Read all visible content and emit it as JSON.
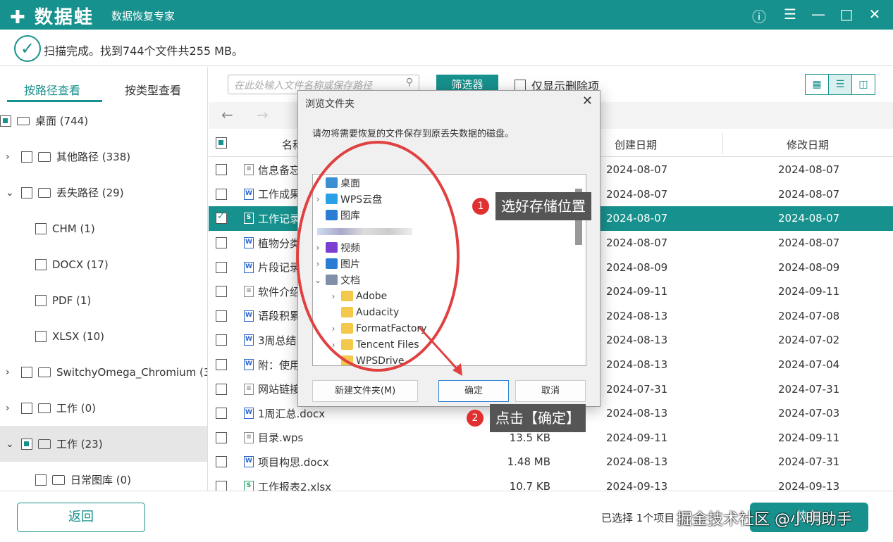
{
  "app": {
    "logo": "数据蛙",
    "subtitle": "数据恢复专家",
    "window_buttons": [
      "help-icon",
      "menu-icon",
      "minimize-icon",
      "maximize-icon",
      "close-icon"
    ]
  },
  "status": {
    "text": "扫描完成。找到744个文件共255 MB。"
  },
  "left": {
    "tabs": [
      "按路径查看",
      "按类型查看"
    ],
    "tree": [
      {
        "label": "桌面 (744)",
        "check": "partial",
        "indent": 0,
        "arrow": "",
        "icon": "desktop"
      },
      {
        "label": "其他路径 (338)",
        "check": "none",
        "indent": 1,
        "arrow": "right",
        "icon": "folder"
      },
      {
        "label": "丢失路径 (29)",
        "check": "none",
        "indent": 1,
        "arrow": "down",
        "icon": "folder"
      },
      {
        "label": "CHM (1)",
        "check": "none",
        "indent": 2,
        "arrow": "",
        "icon": ""
      },
      {
        "label": "DOCX (17)",
        "check": "none",
        "indent": 2,
        "arrow": "",
        "icon": ""
      },
      {
        "label": "PDF (1)",
        "check": "none",
        "indent": 2,
        "arrow": "",
        "icon": ""
      },
      {
        "label": "XLSX (10)",
        "check": "none",
        "indent": 2,
        "arrow": "",
        "icon": ""
      },
      {
        "label": "SwitchyOmega_Chromium (3",
        "check": "none",
        "indent": 1,
        "arrow": "right",
        "icon": "folder"
      },
      {
        "label": "工作 (0)",
        "check": "none",
        "indent": 1,
        "arrow": "right",
        "icon": "folder"
      },
      {
        "label": "工作 (23)",
        "check": "partial",
        "indent": 1,
        "arrow": "down",
        "icon": "folder",
        "selected": true
      },
      {
        "label": "日常图库 (0)",
        "check": "none",
        "indent": 2,
        "arrow": "",
        "icon": "folder"
      }
    ]
  },
  "toolbar": {
    "search_placeholder": "在此处输入文件名称或保存路径",
    "filter": "筛选器",
    "only_deleted": "仅显示删除项"
  },
  "table": {
    "headers": [
      "名称",
      "创建日期",
      "修改日期"
    ],
    "rows": [
      {
        "name": "信息备忘.tx",
        "size": "",
        "created": "2024-08-07",
        "modified": "2024-08-07",
        "type": "txt"
      },
      {
        "name": "工作成果分",
        "size": "",
        "created": "2024-08-07",
        "modified": "2024-08-07",
        "type": "doc"
      },
      {
        "name": "工作记录表",
        "size": "",
        "created": "2024-08-07",
        "modified": "2024-08-07",
        "type": "xls",
        "selected": true
      },
      {
        "name": "植物分类.d",
        "size": "",
        "created": "2024-08-07",
        "modified": "2024-08-07",
        "type": "doc"
      },
      {
        "name": "片段记录.d",
        "size": "",
        "created": "2024-08-09",
        "modified": "2024-08-09",
        "type": "doc"
      },
      {
        "name": "软件介绍 -",
        "size": "",
        "created": "2024-09-11",
        "modified": "2024-09-11",
        "type": "txt"
      },
      {
        "name": "语段积累.d",
        "size": "",
        "created": "2024-08-13",
        "modified": "2024-07-08",
        "type": "doc"
      },
      {
        "name": "3周总结.doc",
        "size": "",
        "created": "2024-08-13",
        "modified": "2024-07-02",
        "type": "doc"
      },
      {
        "name": "附：使用注",
        "size": "",
        "created": "2024-08-13",
        "modified": "2024-07-04",
        "type": "doc"
      },
      {
        "name": "网站链接.tx",
        "size": "",
        "created": "2024-07-31",
        "modified": "2024-07-31",
        "type": "txt"
      },
      {
        "name": "1周汇总.docx",
        "size": "",
        "created": "2024-08-13",
        "modified": "2024-07-03",
        "type": "doc"
      },
      {
        "name": "目录.wps",
        "size": "13.5 KB",
        "created": "2024-09-11",
        "modified": "2024-09-11",
        "type": "txt"
      },
      {
        "name": "项目构思.docx",
        "size": "1.48 MB",
        "created": "2024-08-13",
        "modified": "2024-07-31",
        "type": "doc"
      },
      {
        "name": "工作报表2.xlsx",
        "size": "10.7 KB",
        "created": "2024-09-13",
        "modified": "2024-09-13",
        "type": "xls"
      }
    ]
  },
  "footer": {
    "back": "返回",
    "selection": "已选择 1个项目",
    "recover": "恢复",
    "watermark": "掘金技术社区 @小明助手"
  },
  "dialog": {
    "title": "浏览文件夹",
    "message": "请勿将需要恢复的文件保存到原丢失数据的磁盘。",
    "items": [
      {
        "label": "桌面",
        "indent": 0,
        "arrow": "",
        "icon": "desktop"
      },
      {
        "label": "WPS云盘",
        "indent": 1,
        "arrow": "right",
        "icon": "cloud"
      },
      {
        "label": "图库",
        "indent": 1,
        "arrow": "",
        "icon": "gallery"
      },
      {
        "label": "",
        "indent": 0,
        "arrow": "",
        "icon": "blurred"
      },
      {
        "label": "视频",
        "indent": 1,
        "arrow": "right",
        "icon": "video"
      },
      {
        "label": "图片",
        "indent": 1,
        "arrow": "right",
        "icon": "pictures"
      },
      {
        "label": "文档",
        "indent": 1,
        "arrow": "down",
        "icon": "documents"
      },
      {
        "label": "Adobe",
        "indent": 2,
        "arrow": "right",
        "icon": "folder"
      },
      {
        "label": "Audacity",
        "indent": 2,
        "arrow": "",
        "icon": "folder"
      },
      {
        "label": "FormatFactory",
        "indent": 2,
        "arrow": "right",
        "icon": "folder"
      },
      {
        "label": "Tencent Files",
        "indent": 2,
        "arrow": "right",
        "icon": "folder"
      },
      {
        "label": "WPSDrive",
        "indent": 2,
        "arrow": "",
        "icon": "folder"
      }
    ],
    "new_folder": "新建文件夹(M)",
    "ok": "确定",
    "cancel": "取消"
  },
  "annotations": {
    "step1_num": "1",
    "step1": "选好存储位置",
    "step2_num": "2",
    "step2": "点击【确定】"
  },
  "colors": {
    "accent": "#17918d",
    "annotation_red": "#e04040"
  }
}
